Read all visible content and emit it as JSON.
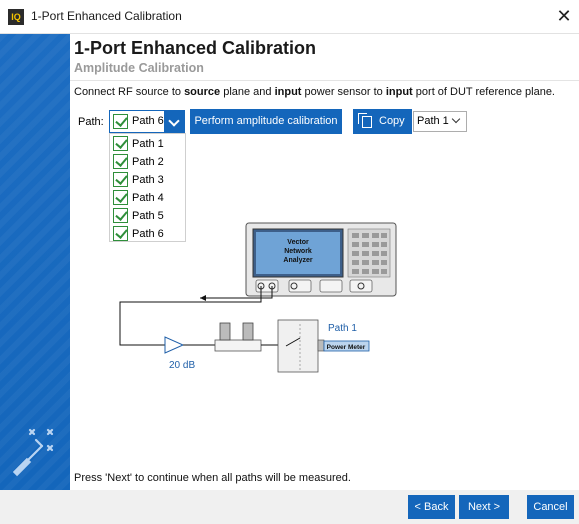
{
  "window": {
    "app_icon_text": "IQ",
    "title": "1-Port Enhanced Calibration",
    "close_glyph": "✕"
  },
  "header": {
    "title": "1-Port Enhanced Calibration",
    "subtitle": "Amplitude Calibration"
  },
  "instruction": {
    "part1": "Connect RF source to ",
    "bold1": "source",
    "part2": " plane and ",
    "bold2": "input",
    "part3": " power sensor to ",
    "bold3": "input",
    "part4": " port of DUT reference plane."
  },
  "path_selector": {
    "label": "Path:",
    "selected": "Path 6",
    "options": [
      "Path 1",
      "Path 2",
      "Path 3",
      "Path 4",
      "Path 5",
      "Path 6"
    ],
    "options_checked": [
      true,
      true,
      true,
      true,
      true,
      true
    ]
  },
  "buttons": {
    "perform": "Perform amplitude calibration",
    "copy": "Copy",
    "back": "< Back",
    "next": "Next >",
    "cancel": "Cancel"
  },
  "copy_target": {
    "selected": "Path 1"
  },
  "diagram": {
    "vna_label_line1": "Vector",
    "vna_label_line2": "Network",
    "vna_label_line3": "Analyzer",
    "attenuator_label": "20 dB",
    "path_label": "Path 1",
    "power_meter_label": "Power Meter"
  },
  "footer_note": "Press 'Next' to continue when all paths will be measured.",
  "colors": {
    "accent": "#1466bb",
    "check": "#2f8f3a",
    "label_blue": "#1f5fa8"
  }
}
